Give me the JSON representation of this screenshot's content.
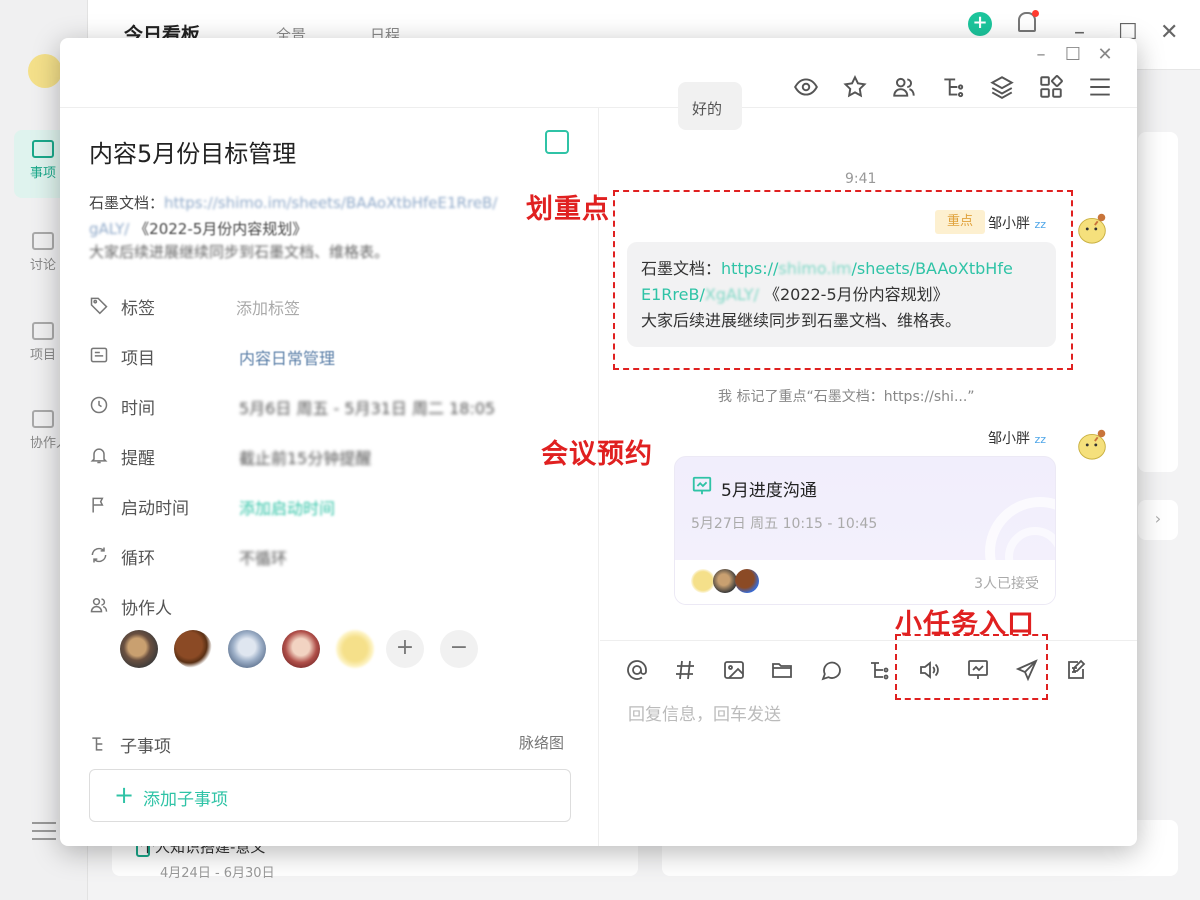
{
  "background": {
    "app_title": "今日看板",
    "tabs": [
      "全景",
      "日程"
    ],
    "nav": [
      {
        "label": "事项",
        "icon": "calendar-icon"
      },
      {
        "label": "讨论",
        "icon": "lightning-icon"
      },
      {
        "label": "项目",
        "icon": "folder-icon"
      },
      {
        "label": "协作人",
        "icon": "people-icon"
      }
    ],
    "task_title": "个人知识搭建-意义",
    "task_date": "4月24日 - 6月30日"
  },
  "modal": {
    "title": "内容5月份目标管理",
    "desc_prefix": "石墨文档：",
    "desc_link": "https://shimo.im/sheets/BAAoXtbHfeE1RreB/",
    "desc_link2": "gALY/",
    "desc_doc": "《2022-5月份内容规划》",
    "desc_line2": "大家后续进展继续同步到石墨文档、维格表。",
    "properties": [
      {
        "label": "标签",
        "value": "添加标签",
        "icon": "tag-icon"
      },
      {
        "label": "项目",
        "value": "内容日常管理",
        "icon": "project-icon"
      },
      {
        "label": "时间",
        "value": "5月6日 周五  -  5月31日 周二 18:05",
        "icon": "clock-icon"
      },
      {
        "label": "提醒",
        "value": "截止前15分钟提醒",
        "icon": "bell-icon"
      },
      {
        "label": "启动时间",
        "value": "添加启动时间",
        "icon": "flag-icon"
      },
      {
        "label": "循环",
        "value": "不循环",
        "icon": "loop-icon"
      },
      {
        "label": "协作人",
        "value": "",
        "icon": "collaborator-icon"
      }
    ],
    "avatar_add": "+",
    "avatar_remove": "−",
    "subtasks_label": "子事项",
    "subtasks_link": "脉络图",
    "add_subtask": "添加子事项"
  },
  "chat": {
    "prev_message": "好的",
    "timestamp": "9:41",
    "sender": "邹小胖",
    "highlight_tag": "重点",
    "msg_prefix": "石墨文档：",
    "msg_link_a": "https://",
    "msg_link_blur1": "shimo.im",
    "msg_link_b": "/sheets/BAAoXtbHfe",
    "msg_link_c": "E1RreB/",
    "msg_link_blur2": "XgALY/",
    "msg_doc": "《2022-5月份内容规划》",
    "msg_line3": "大家后续进展继续同步到石墨文档、维格表。",
    "system_msg": "我 标记了重点“石墨文档：https://shi...”",
    "meeting": {
      "title": "5月进度沟通",
      "time": "5月27日 周五 10:15 - 10:45",
      "accepted": "3人已接受"
    },
    "input_placeholder": "回复信息，回车发送"
  },
  "annotations": {
    "highlight": "划重点",
    "meeting": "会议预约",
    "mini_task": "小任务入口"
  },
  "colors": {
    "accent": "#2fc3a6",
    "annotation": "#e02020",
    "tag_bg": "#fdf0d0",
    "tag_text": "#e0a13a"
  }
}
